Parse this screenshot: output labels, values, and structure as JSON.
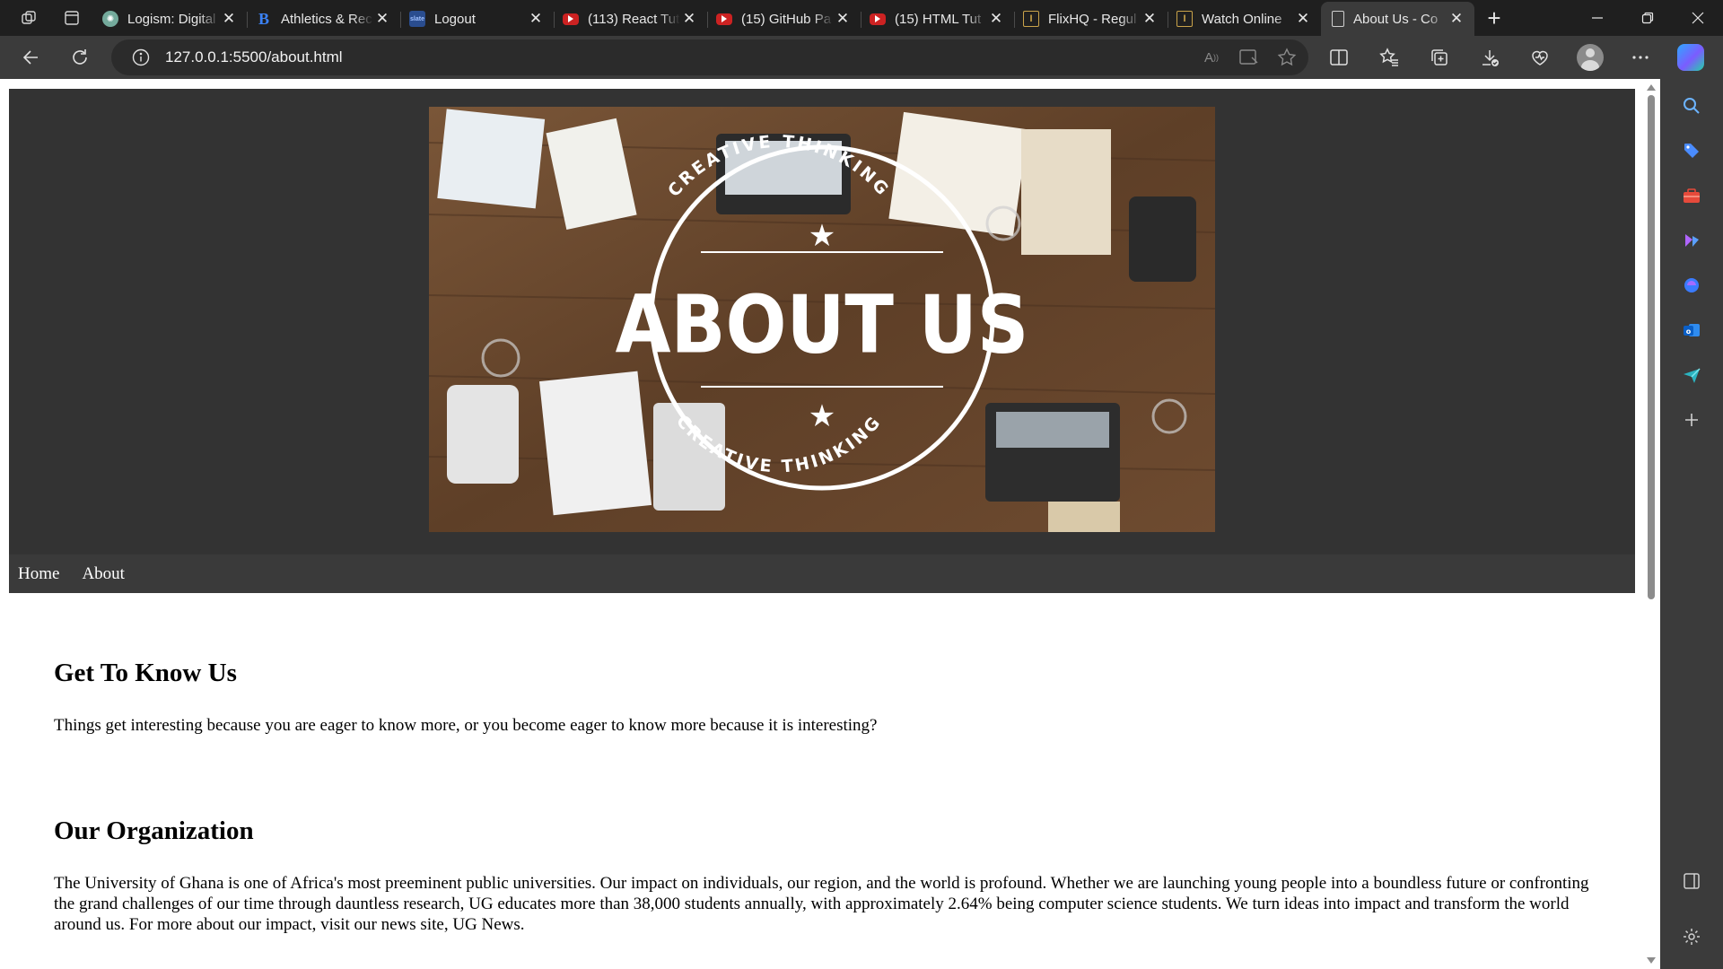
{
  "browser": {
    "tabs": [
      {
        "title": "Logism: Digital",
        "favicon": "chatgpt-icon",
        "active": false
      },
      {
        "title": "Athletics & Rec",
        "favicon": "bootstrap-b-icon",
        "active": false
      },
      {
        "title": "Logout",
        "favicon": "slate-icon",
        "active": false
      },
      {
        "title": "(113) React Tut",
        "favicon": "youtube-icon",
        "active": false
      },
      {
        "title": "(15) GitHub Pa",
        "favicon": "youtube-icon",
        "active": false
      },
      {
        "title": "(15) HTML Tut",
        "favicon": "youtube-icon",
        "active": false
      },
      {
        "title": "FlixHQ - Regul",
        "favicon": "flixhq-icon",
        "active": false
      },
      {
        "title": "Watch Online",
        "favicon": "flixhq-icon",
        "active": false
      },
      {
        "title": "About Us - Co",
        "favicon": "document-icon",
        "active": true
      }
    ],
    "address": {
      "url": "127.0.0.1:5500/about.html"
    }
  },
  "page": {
    "hero": {
      "badge_top": "CREATIVE THINKING",
      "badge_title": "ABOUT US",
      "badge_bottom": "CREATIVE THINKING"
    },
    "nav": {
      "home": "Home",
      "about": "About"
    },
    "sections": [
      {
        "heading": "Get To Know Us",
        "text": "Things get interesting because you are eager to know more, or you become eager to know more because it is interesting?"
      },
      {
        "heading": "Our Organization",
        "text": "The University of Ghana is one of Africa's most preeminent public universities. Our impact on individuals, our region, and the world is profound. Whether we are launching young people into a boundless future or confronting the grand challenges of our time through dauntless research, UG educates more than 38,000 students annually, with approximately 2.64% being computer science students. We turn ideas into impact and transform the world around us. For more about our impact, visit our news site, UG News."
      }
    ]
  },
  "colors": {
    "tabstrip_bg": "#1f1f1f",
    "toolbar_bg": "#3b3b3b",
    "hero_bg": "#333333",
    "nav_bg": "#3a3a3a",
    "wood": "#6b4a30"
  }
}
